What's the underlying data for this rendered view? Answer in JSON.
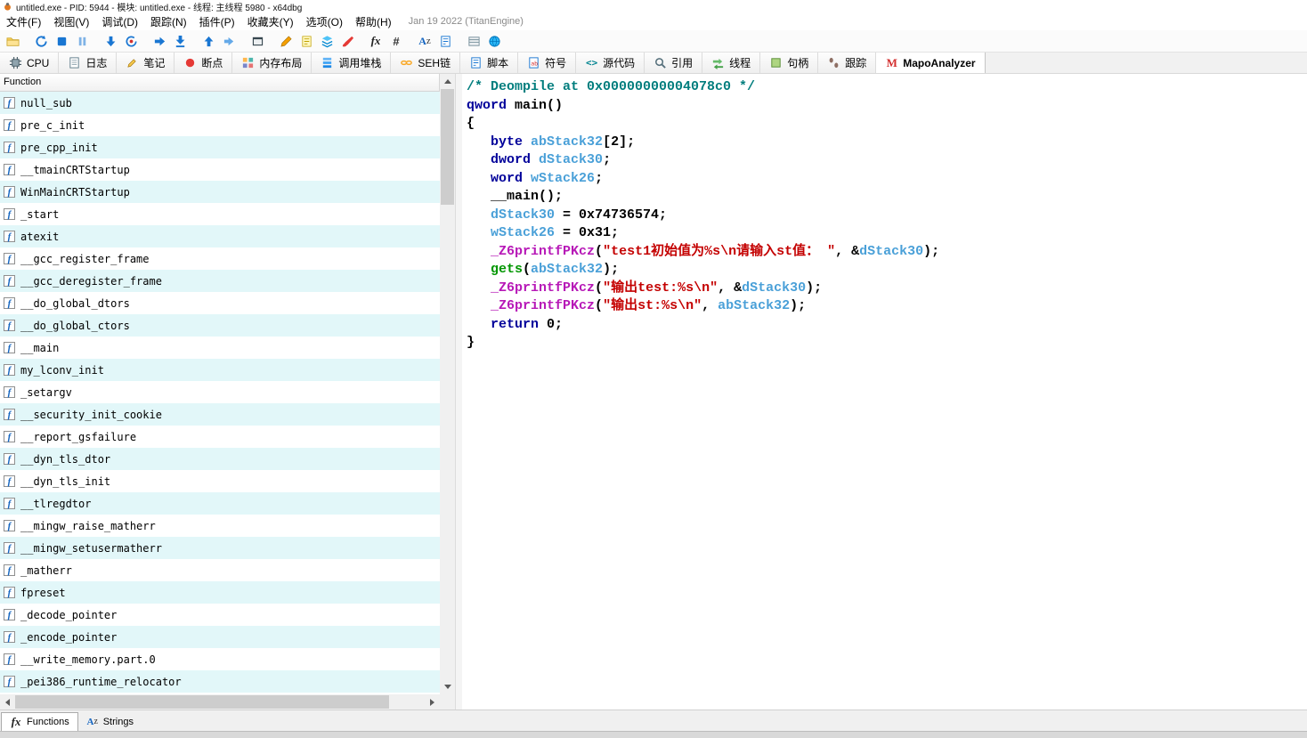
{
  "window": {
    "title": "untitled.exe - PID: 5944 - 模块: untitled.exe - 线程: 主线程 5980 - x64dbg"
  },
  "menu": {
    "items": [
      {
        "id": "file",
        "label": "文件(F)"
      },
      {
        "id": "view",
        "label": "视图(V)"
      },
      {
        "id": "debug",
        "label": "调试(D)"
      },
      {
        "id": "trace",
        "label": "跟踪(N)"
      },
      {
        "id": "plugins",
        "label": "插件(P)"
      },
      {
        "id": "favourites",
        "label": "收藏夹(Y)"
      },
      {
        "id": "options",
        "label": "选项(O)"
      },
      {
        "id": "help",
        "label": "帮助(H)"
      }
    ],
    "right_text": "Jan 19 2022 (TitanEngine)"
  },
  "toolbar": {
    "icons": [
      {
        "name": "open-folder-icon"
      },
      {
        "name": "restart-icon",
        "gap": true
      },
      {
        "name": "stop-icon"
      },
      {
        "name": "pause-icon"
      },
      {
        "name": "step-into-icon",
        "gap": true
      },
      {
        "name": "run-to-user-icon"
      },
      {
        "name": "step-over-icon",
        "gap": true
      },
      {
        "name": "execute-till-return-icon"
      },
      {
        "name": "step-out-icon",
        "gap": true
      },
      {
        "name": "skip-exception-icon"
      },
      {
        "name": "debuggee-window-icon",
        "gap": true
      },
      {
        "name": "pencil-icon",
        "gap": true
      },
      {
        "name": "notes-icon"
      },
      {
        "name": "layers-icon"
      },
      {
        "name": "clean-icon"
      },
      {
        "name": "fx-icon",
        "gap": true
      },
      {
        "name": "hash-icon"
      },
      {
        "name": "font-icon",
        "gap": true
      },
      {
        "name": "script-icon"
      },
      {
        "name": "memory-icon",
        "gap": true
      },
      {
        "name": "globe-icon"
      }
    ]
  },
  "tabs": {
    "items": [
      {
        "id": "cpu",
        "icon": "cpu-icon",
        "label": "CPU",
        "active": false
      },
      {
        "id": "log",
        "icon": "log-icon",
        "label": "日志",
        "active": false
      },
      {
        "id": "notes",
        "icon": "note-icon",
        "label": "笔记",
        "active": false
      },
      {
        "id": "breakpoints",
        "icon": "breakpoint-icon",
        "label": "断点",
        "active": false
      },
      {
        "id": "memory-map",
        "icon": "memmap-icon",
        "label": "内存布局",
        "active": false
      },
      {
        "id": "call-stack",
        "icon": "callstack-icon",
        "label": "调用堆栈",
        "active": false
      },
      {
        "id": "seh-chain",
        "icon": "seh-icon",
        "label": "SEH链",
        "active": false
      },
      {
        "id": "script",
        "icon": "script-tab-icon",
        "label": "脚本",
        "active": false
      },
      {
        "id": "symbols",
        "icon": "symbols-icon",
        "label": "符号",
        "active": false
      },
      {
        "id": "source",
        "icon": "source-icon",
        "label": "源代码",
        "active": false
      },
      {
        "id": "references",
        "icon": "references-icon",
        "label": "引用",
        "active": false
      },
      {
        "id": "threads",
        "icon": "threads-icon",
        "label": "线程",
        "active": false
      },
      {
        "id": "handles",
        "icon": "handles-icon",
        "label": "句柄",
        "active": false
      },
      {
        "id": "trace",
        "icon": "trace-icon",
        "label": "跟踪",
        "active": false
      },
      {
        "id": "mapoanalyzer",
        "icon": "mapo-icon",
        "label": "MapoAnalyzer",
        "active": true
      }
    ]
  },
  "functions_panel": {
    "header": "Function",
    "items": [
      "null_sub",
      "pre_c_init",
      "pre_cpp_init",
      "__tmainCRTStartup",
      "WinMainCRTStartup",
      "_start",
      "atexit",
      "__gcc_register_frame",
      "__gcc_deregister_frame",
      "__do_global_dtors",
      "__do_global_ctors",
      "__main",
      "my_lconv_init",
      "_setargv",
      "__security_init_cookie",
      "__report_gsfailure",
      "__dyn_tls_dtor",
      "__dyn_tls_init",
      "__tlregdtor",
      "__mingw_raise_matherr",
      "__mingw_setusermatherr",
      "_matherr",
      "fpreset",
      "_decode_pointer",
      "_encode_pointer",
      "__write_memory.part.0",
      "_pei386_runtime_relocator"
    ]
  },
  "bottom_tabs": [
    {
      "id": "functions",
      "icon": "fx-icon",
      "label": "Functions",
      "active": true
    },
    {
      "id": "strings",
      "icon": "az-icon",
      "label": "Strings",
      "active": false
    }
  ],
  "decompiler": {
    "lines": [
      [
        {
          "t": "/* Deompile at 0x00000000004078c0 */",
          "c": "cm"
        }
      ],
      [
        {
          "t": "qword",
          "c": "kw"
        },
        {
          "t": " main()",
          "c": "pl"
        }
      ],
      [
        {
          "t": "{",
          "c": "pl"
        }
      ],
      [
        {
          "t": "   ",
          "c": "pl"
        },
        {
          "t": "byte",
          "c": "kw"
        },
        {
          "t": " ",
          "c": "pl"
        },
        {
          "t": "abStack32",
          "c": "var"
        },
        {
          "t": "[2];",
          "c": "pl"
        }
      ],
      [
        {
          "t": "   ",
          "c": "pl"
        },
        {
          "t": "dword",
          "c": "kw"
        },
        {
          "t": " ",
          "c": "pl"
        },
        {
          "t": "dStack30",
          "c": "var"
        },
        {
          "t": ";",
          "c": "pl"
        }
      ],
      [
        {
          "t": "   ",
          "c": "pl"
        },
        {
          "t": "word",
          "c": "kw"
        },
        {
          "t": " ",
          "c": "pl"
        },
        {
          "t": "wStack26",
          "c": "var"
        },
        {
          "t": ";",
          "c": "pl"
        }
      ],
      [
        {
          "t": "   __main();",
          "c": "pl"
        }
      ],
      [
        {
          "t": "   ",
          "c": "pl"
        },
        {
          "t": "dStack30",
          "c": "var"
        },
        {
          "t": " = 0x74736574;",
          "c": "pl"
        }
      ],
      [
        {
          "t": "   ",
          "c": "pl"
        },
        {
          "t": "wStack26",
          "c": "var"
        },
        {
          "t": " = 0x31;",
          "c": "pl"
        }
      ],
      [
        {
          "t": "   ",
          "c": "pl"
        },
        {
          "t": "_Z6printfPKcz",
          "c": "fn"
        },
        {
          "t": "(",
          "c": "pl"
        },
        {
          "t": "\"test1初始值为%s\\n请输入st值： \"",
          "c": "str"
        },
        {
          "t": ", &",
          "c": "pl"
        },
        {
          "t": "dStack30",
          "c": "var"
        },
        {
          "t": ");",
          "c": "pl"
        }
      ],
      [
        {
          "t": "   ",
          "c": "pl"
        },
        {
          "t": "gets",
          "c": "grn"
        },
        {
          "t": "(",
          "c": "pl"
        },
        {
          "t": "abStack32",
          "c": "var"
        },
        {
          "t": ");",
          "c": "pl"
        }
      ],
      [
        {
          "t": "   ",
          "c": "pl"
        },
        {
          "t": "_Z6printfPKcz",
          "c": "fn"
        },
        {
          "t": "(",
          "c": "pl"
        },
        {
          "t": "\"输出test:%s\\n\"",
          "c": "str"
        },
        {
          "t": ", &",
          "c": "pl"
        },
        {
          "t": "dStack30",
          "c": "var"
        },
        {
          "t": ");",
          "c": "pl"
        }
      ],
      [
        {
          "t": "   ",
          "c": "pl"
        },
        {
          "t": "_Z6printfPKcz",
          "c": "fn"
        },
        {
          "t": "(",
          "c": "pl"
        },
        {
          "t": "\"输出st:%s\\n\"",
          "c": "str"
        },
        {
          "t": ", ",
          "c": "pl"
        },
        {
          "t": "abStack32",
          "c": "var"
        },
        {
          "t": ");",
          "c": "pl"
        }
      ],
      [
        {
          "t": "   ",
          "c": "pl"
        },
        {
          "t": "return",
          "c": "kw"
        },
        {
          "t": " 0;",
          "c": "pl"
        }
      ],
      [
        {
          "t": "}",
          "c": "pl"
        }
      ]
    ]
  },
  "colors": {
    "keyword": "#00009a",
    "variable": "#4aa0d8",
    "function_call": "#b718b7",
    "library_call": "#009600",
    "string": "#c40000",
    "comment": "#007d7d",
    "plain": "#000000",
    "stripe": "#e2f7f9",
    "accent_blue": "#1976d2"
  }
}
